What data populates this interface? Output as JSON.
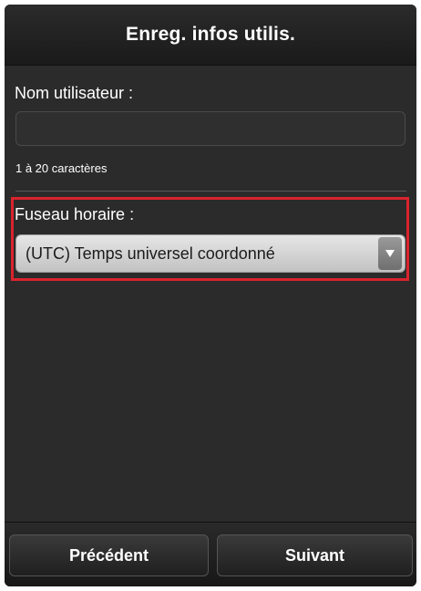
{
  "header": {
    "title": "Enreg. infos utilis."
  },
  "username": {
    "label": "Nom utilisateur :",
    "value": "",
    "placeholder": "",
    "hint": "1 à 20 caractères"
  },
  "timezone": {
    "label": "Fuseau horaire :",
    "selected": "(UTC) Temps universel coordonné",
    "highlight_color": "#d9232d"
  },
  "footer": {
    "previous_label": "Précédent",
    "next_label": "Suivant"
  },
  "icons": {
    "dropdown": "chevron-down-icon"
  }
}
